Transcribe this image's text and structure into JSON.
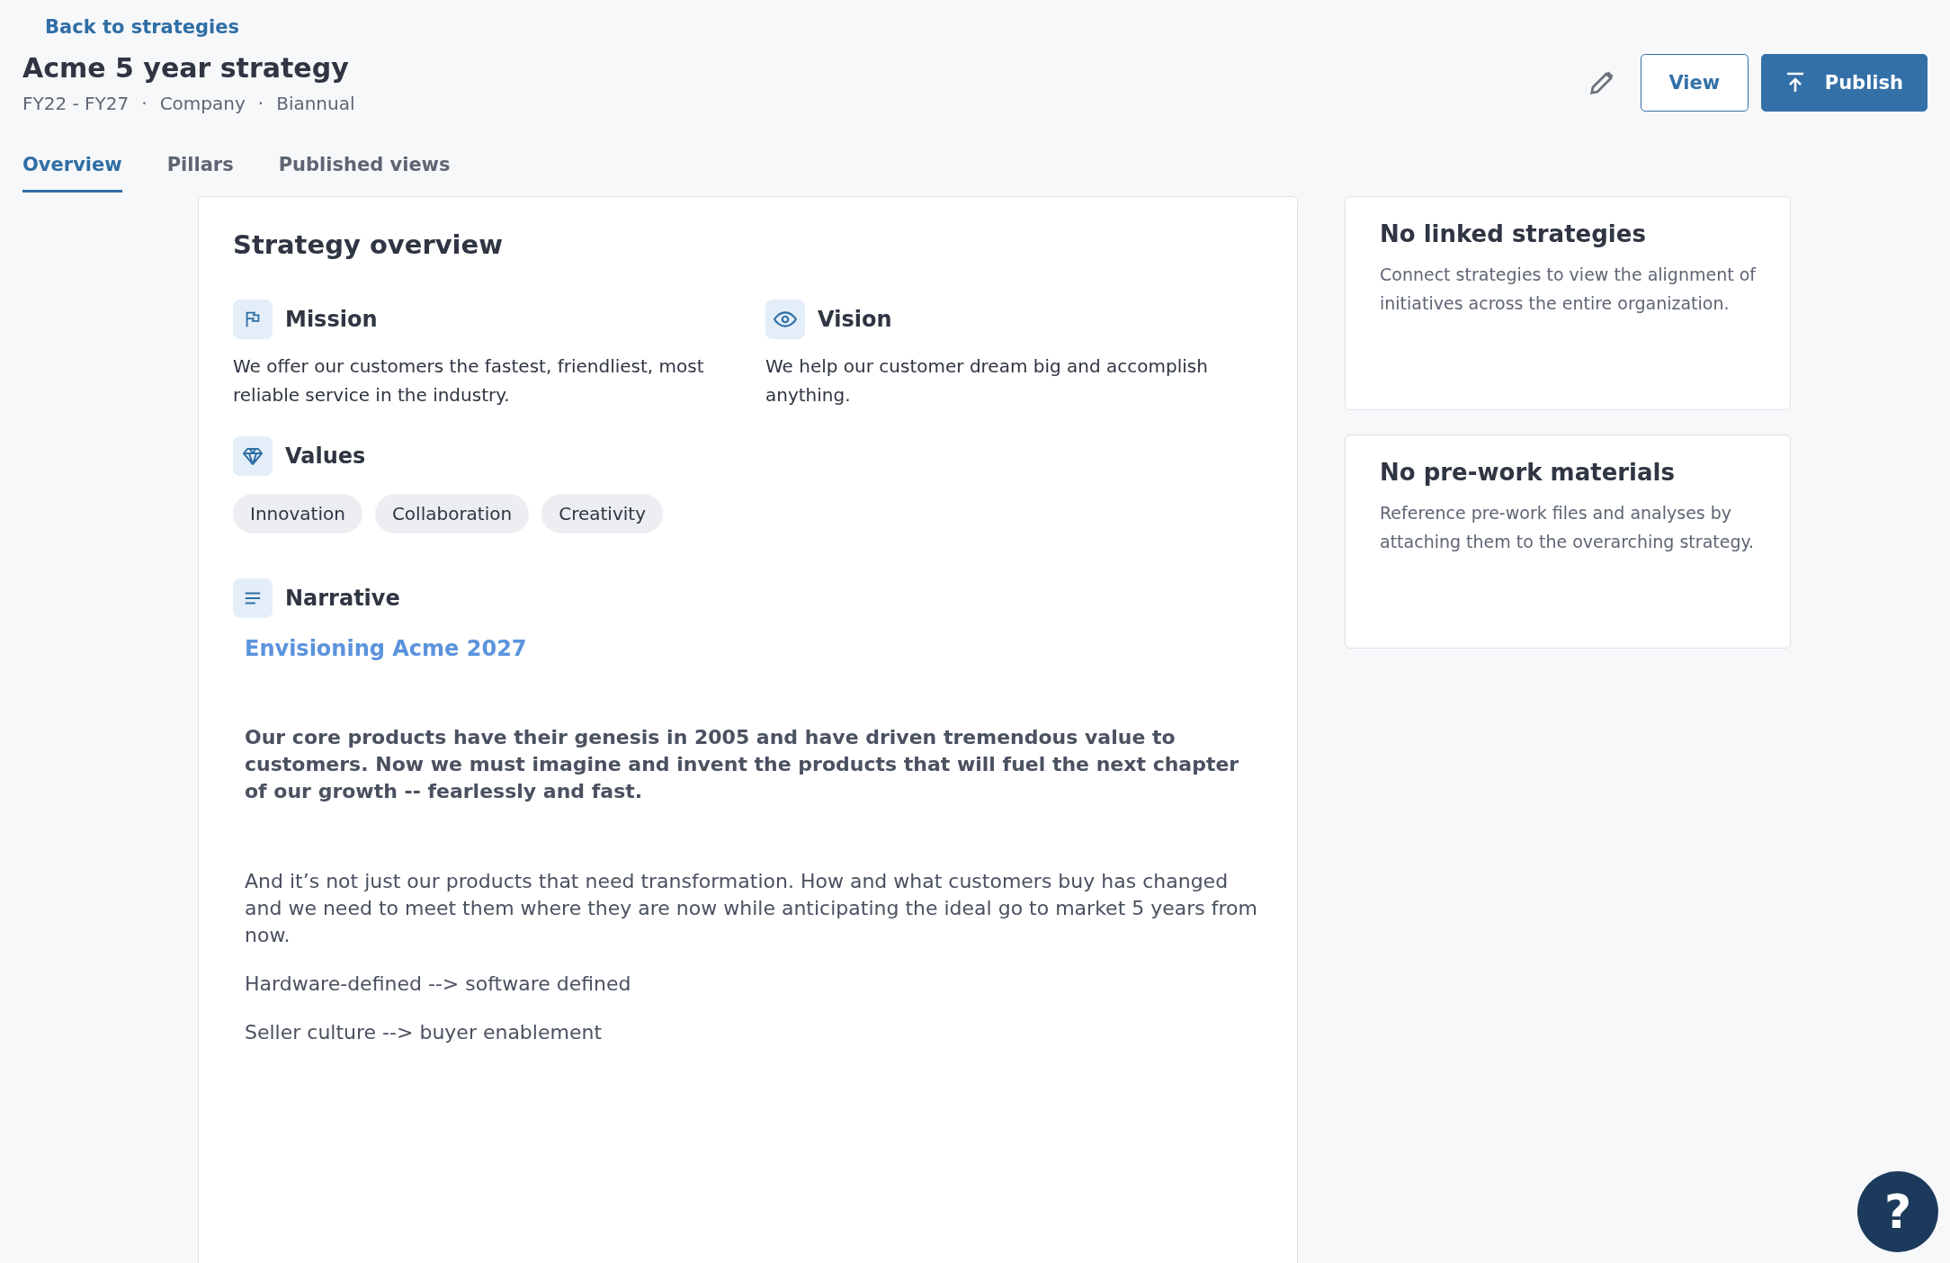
{
  "back_link": "Back to strategies",
  "title": "Acme 5 year strategy",
  "meta": [
    "FY22 - FY27",
    "Company",
    "Biannual"
  ],
  "separator": "·",
  "actions": {
    "view": "View",
    "publish": "Publish"
  },
  "tabs": [
    {
      "label": "Overview",
      "selected": true
    },
    {
      "label": "Pillars",
      "selected": false
    },
    {
      "label": "Published views",
      "selected": false
    }
  ],
  "overview": {
    "title": "Strategy overview",
    "mission": {
      "label": "Mission",
      "text": "We offer our customers the fastest, friendliest, most reliable service in the industry."
    },
    "vision": {
      "label": "Vision",
      "text": "We help our customer dream big and accomplish anything."
    },
    "values": {
      "label": "Values",
      "items": [
        "Innovation",
        "Collaboration",
        "Creativity"
      ]
    },
    "narrative": {
      "label": "Narrative",
      "heading": "Envisioning Acme 2027",
      "paragraphs": [
        {
          "kind": "bold",
          "text": "Our core products have their genesis in 2005 and have driven tremendous value to customers. Now we must imagine and invent the products that will fuel the next chapter of our growth -- fearlessly and fast."
        },
        {
          "kind": "plain",
          "text": "And it’s not just our products that need transformation. How and what customers buy has changed and we need to meet them where they are now while anticipating the ideal go to market 5 years from now."
        },
        {
          "kind": "line",
          "text": "Hardware-defined --> software defined"
        },
        {
          "kind": "line",
          "text": "Seller culture --> buyer enablement"
        }
      ]
    }
  },
  "side_cards": [
    {
      "title": "No linked strategies",
      "text": "Connect strategies to view the alignment of initiatives across the entire organization."
    },
    {
      "title": "No pre-work materials",
      "text": "Reference pre-work files and analyses by attaching them to the overarching strategy."
    }
  ],
  "help": "?"
}
